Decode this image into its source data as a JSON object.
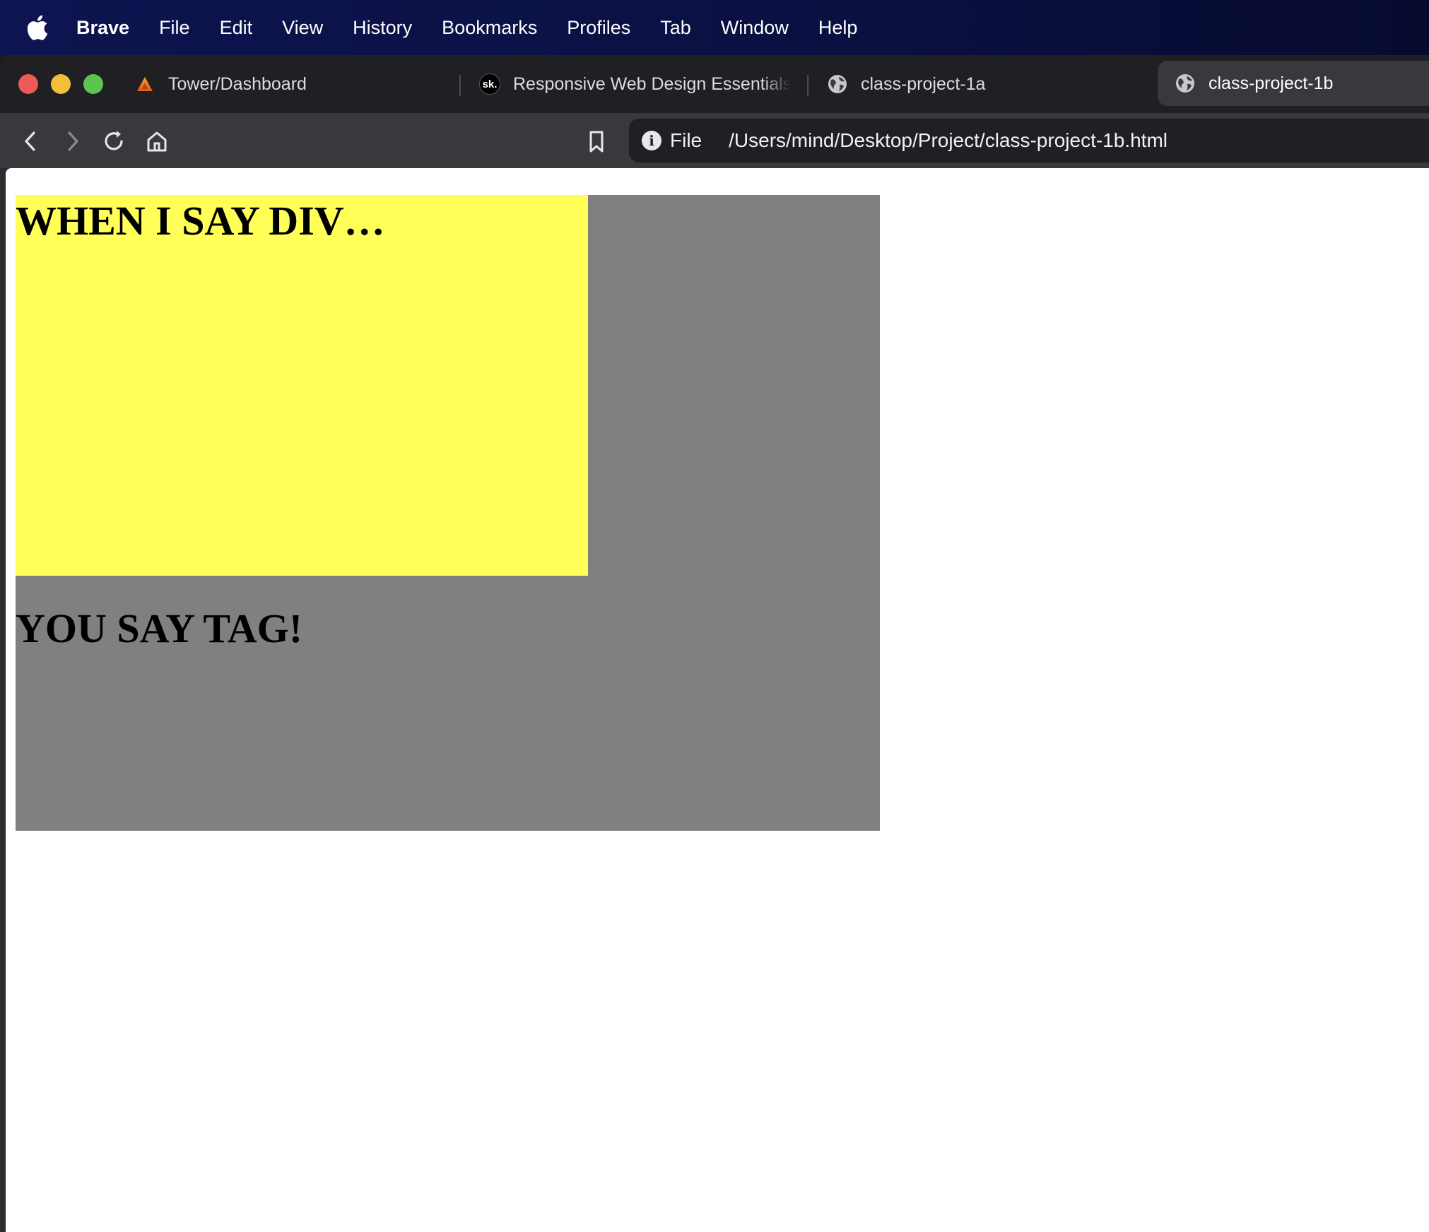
{
  "menubar": {
    "app_name": "Brave",
    "items": [
      "File",
      "Edit",
      "View",
      "History",
      "Bookmarks",
      "Profiles",
      "Tab",
      "Window",
      "Help"
    ]
  },
  "tabs": [
    {
      "title": "Tower/Dashboard",
      "icon": "brave-icon"
    },
    {
      "title": "Responsive Web Design Essentials",
      "icon": "sk-logo",
      "icon_text": "sk."
    },
    {
      "title": "class-project-1a",
      "icon": "globe-icon"
    },
    {
      "title": "class-project-1b",
      "icon": "globe-icon",
      "active": true
    }
  ],
  "urlbar": {
    "scheme_label": "File",
    "path": "/Users/mind/Desktop/Project/class-project-1b.html"
  },
  "page": {
    "heading_1": "WHEN I SAY DIV…",
    "heading_2": "YOU SAY TAG!"
  },
  "colors": {
    "outer_div": "#808080",
    "inner_div": "#ffff57",
    "menubar": "#0d1450"
  }
}
